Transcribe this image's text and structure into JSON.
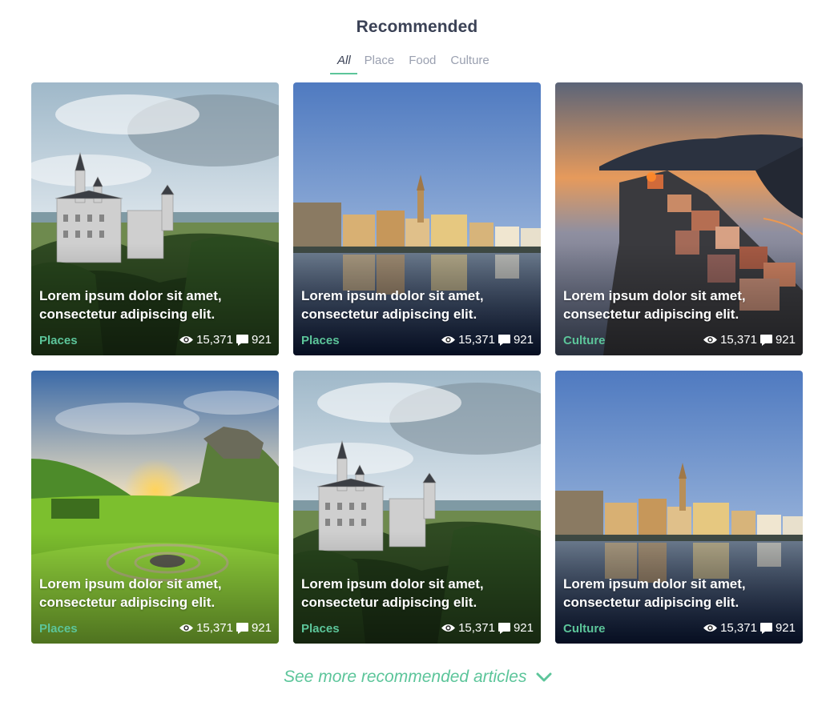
{
  "header": {
    "title": "Recommended"
  },
  "tabs": [
    "All",
    "Place",
    "Food",
    "Culture"
  ],
  "cards": [
    {
      "headline": "Lorem ipsum dolor sit amet, consectetur adipiscing elit.",
      "category": "Places",
      "views": "15,371",
      "comments": "921",
      "image": "castle"
    },
    {
      "headline": "Lorem ipsum dolor sit amet, consectetur adipiscing elit.",
      "category": "Places",
      "views": "15,371",
      "comments": "921",
      "image": "city-river"
    },
    {
      "headline": "Lorem ipsum dolor sit amet, consectetur adipiscing elit.",
      "category": "Culture",
      "views": "15,371",
      "comments": "921",
      "image": "cliff-village-sunset"
    },
    {
      "headline": "Lorem ipsum dolor sit amet, consectetur adipiscing elit.",
      "category": "Places",
      "views": "15,371",
      "comments": "921",
      "image": "green-valley-sunset"
    },
    {
      "headline": "Lorem ipsum dolor sit amet, consectetur adipiscing elit.",
      "category": "Places",
      "views": "15,371",
      "comments": "921",
      "image": "castle"
    },
    {
      "headline": "Lorem ipsum dolor sit amet, consectetur adipiscing elit.",
      "category": "Culture",
      "views": "15,371",
      "comments": "921",
      "image": "city-river"
    }
  ],
  "footer": {
    "see_more_label": "See more recommended articles"
  },
  "colors": {
    "accent": "#5cc59a",
    "title": "#3b4256",
    "muted": "#9aa0b0"
  },
  "icons": {
    "views": "eye-icon",
    "comments": "speech-bubble-icon",
    "more": "chevron-down-icon"
  }
}
